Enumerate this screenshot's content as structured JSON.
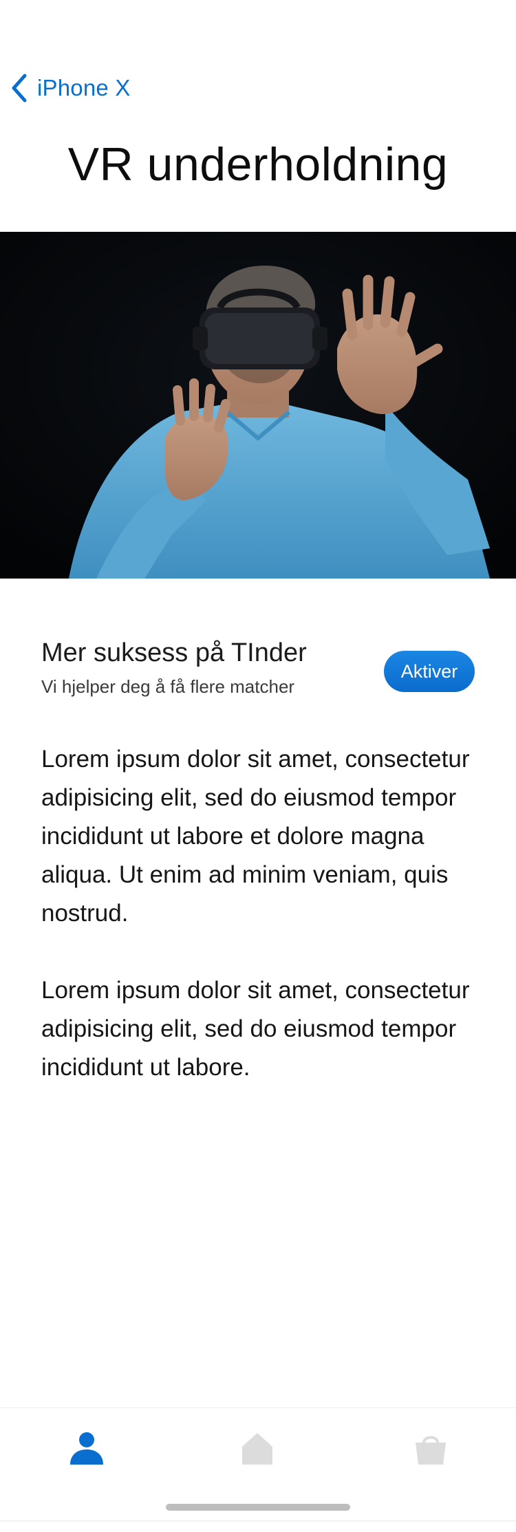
{
  "nav": {
    "back_label": "iPhone X",
    "back_icon": "chevron-left-icon"
  },
  "page": {
    "title": "VR underholdning"
  },
  "hero": {
    "image_description": "man-wearing-vr-headset"
  },
  "promo": {
    "title": "Mer suksess på TInder",
    "subtitle": "Vi hjelper deg å få flere matcher",
    "button_label": "Aktiver"
  },
  "content": {
    "paragraph_1": "Lorem ipsum dolor sit amet, consectetur adipisicing elit, sed do eiusmod tempor incididunt ut labore et dolore magna aliqua. Ut enim ad minim veniam, quis nostrud.",
    "paragraph_2": "Lorem ipsum dolor sit amet, consectetur adipisicing elit, sed do eiusmod tempor incididunt ut labore."
  },
  "tabbar": {
    "tabs": [
      {
        "icon": "person-icon",
        "active": true
      },
      {
        "icon": "home-icon",
        "active": false
      },
      {
        "icon": "shopping-bag-icon",
        "active": false
      }
    ]
  },
  "colors": {
    "accent": "#0a6ecf",
    "button": "#0a73d6",
    "inactive_icon": "#d9d9d9",
    "text": "#111111"
  }
}
